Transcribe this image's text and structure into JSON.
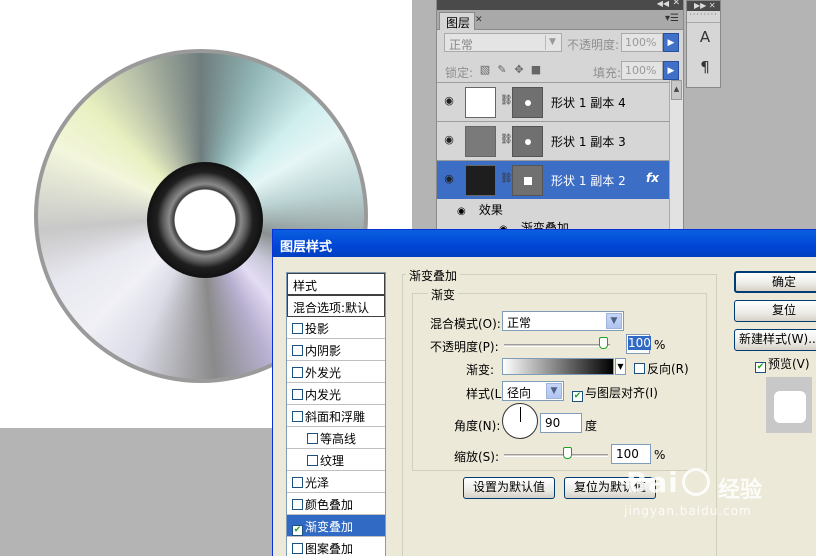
{
  "layers_panel": {
    "tab_label": "图层",
    "blend_mode": "正常",
    "opacity_label": "不透明度:",
    "opacity_value": "100%",
    "lock_label": "锁定:",
    "fill_label": "填充:",
    "fill_value": "100%",
    "layers": [
      {
        "name": "形状 1 副本 4",
        "thumb_color": "#ffffff",
        "mask_shape": "dot",
        "selected": false
      },
      {
        "name": "形状 1 副本 3",
        "thumb_color": "#7a7a7a",
        "mask_shape": "dot",
        "selected": false
      },
      {
        "name": "形状 1 副本 2",
        "thumb_color": "#1e1e1e",
        "mask_shape": "square",
        "selected": true,
        "fx": "fx"
      }
    ],
    "effects_label": "效果",
    "effect_item": "渐变叠加"
  },
  "toolstrip": {
    "icons": [
      "character-icon",
      "paragraph-icon"
    ],
    "glyphs": [
      "A",
      "¶"
    ]
  },
  "dialog": {
    "title": "图层样式",
    "styles_list": {
      "header": "样式",
      "blend_options": "混合选项:默认",
      "items": [
        {
          "label": "投影",
          "checked": false,
          "indent": false
        },
        {
          "label": "内阴影",
          "checked": false,
          "indent": false
        },
        {
          "label": "外发光",
          "checked": false,
          "indent": false
        },
        {
          "label": "内发光",
          "checked": false,
          "indent": false
        },
        {
          "label": "斜面和浮雕",
          "checked": false,
          "indent": false
        },
        {
          "label": "等高线",
          "checked": false,
          "indent": true
        },
        {
          "label": "纹理",
          "checked": false,
          "indent": true
        },
        {
          "label": "光泽",
          "checked": false,
          "indent": false
        },
        {
          "label": "颜色叠加",
          "checked": false,
          "indent": false
        },
        {
          "label": "渐变叠加",
          "checked": true,
          "indent": false,
          "selected": true
        },
        {
          "label": "图案叠加",
          "checked": false,
          "indent": false
        }
      ]
    },
    "section_title": "渐变叠加",
    "group_title": "渐变",
    "blend_mode_label": "混合模式(O):",
    "blend_mode_value": "正常",
    "opacity_label": "不透明度(P):",
    "opacity_value": "100",
    "opacity_unit": "%",
    "gradient_label": "渐变:",
    "reverse_label": "反向(R)",
    "reverse_checked": false,
    "style_label": "样式(L):",
    "style_value": "径向",
    "align_label": "与图层对齐(I)",
    "align_checked": true,
    "angle_label": "角度(N):",
    "angle_value": "90",
    "angle_unit": "度",
    "scale_label": "缩放(S):",
    "scale_value": "100",
    "scale_unit": "%",
    "make_default": "设置为默认值",
    "reset_default": "复位为默认值",
    "buttons": {
      "ok": "确定",
      "reset": "复位",
      "new_style": "新建样式(W)...",
      "preview": "预览(V)"
    },
    "preview_checked": true
  },
  "watermark": {
    "logo_text": "Bai",
    "brand_text": "经验",
    "url": "jingyan.baidu.com"
  }
}
